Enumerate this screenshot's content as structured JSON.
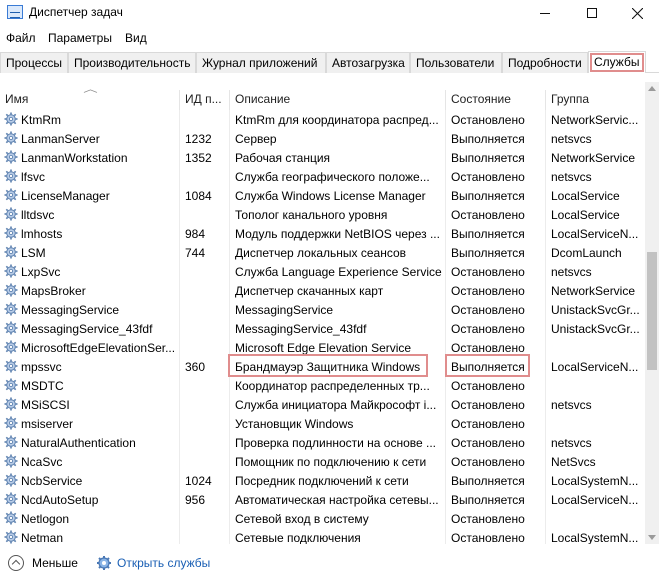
{
  "window": {
    "title": "Диспетчер задач"
  },
  "menu": [
    "Файл",
    "Параметры",
    "Вид"
  ],
  "tabs": [
    "Процессы",
    "Производительность",
    "Журнал приложений",
    "Автозагрузка",
    "Пользователи",
    "Подробности",
    "Службы"
  ],
  "active_tab": "Службы",
  "columns": {
    "name": "Имя",
    "pid": "ИД п...",
    "description": "Описание",
    "status": "Состояние",
    "group": "Группа"
  },
  "rows": [
    {
      "name": "KtmRm",
      "pid": "",
      "description": "KtmRm для координатора распред...",
      "status": "Остановлено",
      "group": "NetworkServic..."
    },
    {
      "name": "LanmanServer",
      "pid": "1232",
      "description": "Сервер",
      "status": "Выполняется",
      "group": "netsvcs"
    },
    {
      "name": "LanmanWorkstation",
      "pid": "1352",
      "description": "Рабочая станция",
      "status": "Выполняется",
      "group": "NetworkService"
    },
    {
      "name": "lfsvc",
      "pid": "",
      "description": "Служба географического положе...",
      "status": "Остановлено",
      "group": "netsvcs"
    },
    {
      "name": "LicenseManager",
      "pid": "1084",
      "description": "Служба Windows License Manager",
      "status": "Выполняется",
      "group": "LocalService"
    },
    {
      "name": "lltdsvc",
      "pid": "",
      "description": "Тополог канального уровня",
      "status": "Остановлено",
      "group": "LocalService"
    },
    {
      "name": "lmhosts",
      "pid": "984",
      "description": "Модуль поддержки NetBIOS через ...",
      "status": "Выполняется",
      "group": "LocalServiceN..."
    },
    {
      "name": "LSM",
      "pid": "744",
      "description": "Диспетчер локальных сеансов",
      "status": "Выполняется",
      "group": "DcomLaunch"
    },
    {
      "name": "LxpSvc",
      "pid": "",
      "description": "Служба Language Experience Service",
      "status": "Остановлено",
      "group": "netsvcs"
    },
    {
      "name": "MapsBroker",
      "pid": "",
      "description": "Диспетчер скачанных карт",
      "status": "Остановлено",
      "group": "NetworkService"
    },
    {
      "name": "MessagingService",
      "pid": "",
      "description": "MessagingService",
      "status": "Остановлено",
      "group": "UnistackSvcGr..."
    },
    {
      "name": "MessagingService_43fdf",
      "pid": "",
      "description": "MessagingService_43fdf",
      "status": "Остановлено",
      "group": "UnistackSvcGr..."
    },
    {
      "name": "MicrosoftEdgeElevationSer...",
      "pid": "",
      "description": "Microsoft Edge Elevation Service",
      "status": "Остановлено",
      "group": ""
    },
    {
      "name": "mpssvc",
      "pid": "360",
      "description": "Брандмауэр Защитника Windows",
      "status": "Выполняется",
      "group": "LocalServiceN..."
    },
    {
      "name": "MSDTC",
      "pid": "",
      "description": "Координатор распределенных тр...",
      "status": "Остановлено",
      "group": ""
    },
    {
      "name": "MSiSCSI",
      "pid": "",
      "description": "Служба инициатора Майкрософт i...",
      "status": "Остановлено",
      "group": "netsvcs"
    },
    {
      "name": "msiserver",
      "pid": "",
      "description": "Установщик Windows",
      "status": "Остановлено",
      "group": ""
    },
    {
      "name": "NaturalAuthentication",
      "pid": "",
      "description": "Проверка подлинности на основе ...",
      "status": "Остановлено",
      "group": "netsvcs"
    },
    {
      "name": "NcaSvc",
      "pid": "",
      "description": "Помощник по подключению к сети",
      "status": "Остановлено",
      "group": "NetSvcs"
    },
    {
      "name": "NcbService",
      "pid": "1024",
      "description": "Посредник подключений к сети",
      "status": "Выполняется",
      "group": "LocalSystemN..."
    },
    {
      "name": "NcdAutoSetup",
      "pid": "956",
      "description": "Автоматическая настройка сетевы...",
      "status": "Выполняется",
      "group": "LocalServiceN..."
    },
    {
      "name": "Netlogon",
      "pid": "",
      "description": "Сетевой вход в систему",
      "status": "Остановлено",
      "group": ""
    },
    {
      "name": "Netman",
      "pid": "",
      "description": "Сетевые подключения",
      "status": "Остановлено",
      "group": "LocalSystemN..."
    }
  ],
  "footer": {
    "less_label": "Меньше",
    "open_services_label": "Открыть службы"
  }
}
